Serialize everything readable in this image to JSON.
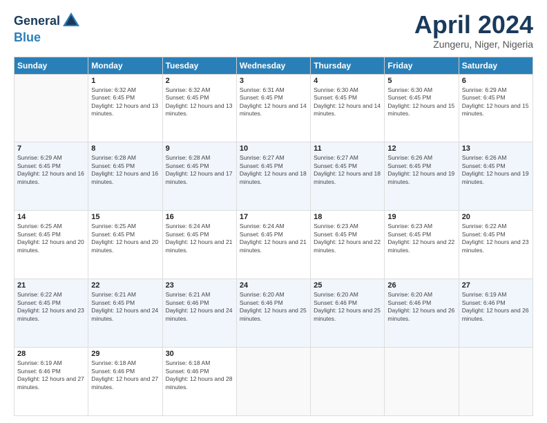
{
  "header": {
    "logo_general": "General",
    "logo_blue": "Blue",
    "month_title": "April 2024",
    "subtitle": "Zungeru, Niger, Nigeria"
  },
  "weekdays": [
    "Sunday",
    "Monday",
    "Tuesday",
    "Wednesday",
    "Thursday",
    "Friday",
    "Saturday"
  ],
  "weeks": [
    [
      {
        "day": "",
        "empty": true
      },
      {
        "day": "1",
        "sunrise": "6:32 AM",
        "sunset": "6:45 PM",
        "daylight": "12 hours and 13 minutes."
      },
      {
        "day": "2",
        "sunrise": "6:32 AM",
        "sunset": "6:45 PM",
        "daylight": "12 hours and 13 minutes."
      },
      {
        "day": "3",
        "sunrise": "6:31 AM",
        "sunset": "6:45 PM",
        "daylight": "12 hours and 14 minutes."
      },
      {
        "day": "4",
        "sunrise": "6:30 AM",
        "sunset": "6:45 PM",
        "daylight": "12 hours and 14 minutes."
      },
      {
        "day": "5",
        "sunrise": "6:30 AM",
        "sunset": "6:45 PM",
        "daylight": "12 hours and 15 minutes."
      },
      {
        "day": "6",
        "sunrise": "6:29 AM",
        "sunset": "6:45 PM",
        "daylight": "12 hours and 15 minutes."
      }
    ],
    [
      {
        "day": "7",
        "sunrise": "6:29 AM",
        "sunset": "6:45 PM",
        "daylight": "12 hours and 16 minutes."
      },
      {
        "day": "8",
        "sunrise": "6:28 AM",
        "sunset": "6:45 PM",
        "daylight": "12 hours and 16 minutes."
      },
      {
        "day": "9",
        "sunrise": "6:28 AM",
        "sunset": "6:45 PM",
        "daylight": "12 hours and 17 minutes."
      },
      {
        "day": "10",
        "sunrise": "6:27 AM",
        "sunset": "6:45 PM",
        "daylight": "12 hours and 18 minutes."
      },
      {
        "day": "11",
        "sunrise": "6:27 AM",
        "sunset": "6:45 PM",
        "daylight": "12 hours and 18 minutes."
      },
      {
        "day": "12",
        "sunrise": "6:26 AM",
        "sunset": "6:45 PM",
        "daylight": "12 hours and 19 minutes."
      },
      {
        "day": "13",
        "sunrise": "6:26 AM",
        "sunset": "6:45 PM",
        "daylight": "12 hours and 19 minutes."
      }
    ],
    [
      {
        "day": "14",
        "sunrise": "6:25 AM",
        "sunset": "6:45 PM",
        "daylight": "12 hours and 20 minutes."
      },
      {
        "day": "15",
        "sunrise": "6:25 AM",
        "sunset": "6:45 PM",
        "daylight": "12 hours and 20 minutes."
      },
      {
        "day": "16",
        "sunrise": "6:24 AM",
        "sunset": "6:45 PM",
        "daylight": "12 hours and 21 minutes."
      },
      {
        "day": "17",
        "sunrise": "6:24 AM",
        "sunset": "6:45 PM",
        "daylight": "12 hours and 21 minutes."
      },
      {
        "day": "18",
        "sunrise": "6:23 AM",
        "sunset": "6:45 PM",
        "daylight": "12 hours and 22 minutes."
      },
      {
        "day": "19",
        "sunrise": "6:23 AM",
        "sunset": "6:45 PM",
        "daylight": "12 hours and 22 minutes."
      },
      {
        "day": "20",
        "sunrise": "6:22 AM",
        "sunset": "6:45 PM",
        "daylight": "12 hours and 23 minutes."
      }
    ],
    [
      {
        "day": "21",
        "sunrise": "6:22 AM",
        "sunset": "6:45 PM",
        "daylight": "12 hours and 23 minutes."
      },
      {
        "day": "22",
        "sunrise": "6:21 AM",
        "sunset": "6:45 PM",
        "daylight": "12 hours and 24 minutes."
      },
      {
        "day": "23",
        "sunrise": "6:21 AM",
        "sunset": "6:46 PM",
        "daylight": "12 hours and 24 minutes."
      },
      {
        "day": "24",
        "sunrise": "6:20 AM",
        "sunset": "6:46 PM",
        "daylight": "12 hours and 25 minutes."
      },
      {
        "day": "25",
        "sunrise": "6:20 AM",
        "sunset": "6:46 PM",
        "daylight": "12 hours and 25 minutes."
      },
      {
        "day": "26",
        "sunrise": "6:20 AM",
        "sunset": "6:46 PM",
        "daylight": "12 hours and 26 minutes."
      },
      {
        "day": "27",
        "sunrise": "6:19 AM",
        "sunset": "6:46 PM",
        "daylight": "12 hours and 26 minutes."
      }
    ],
    [
      {
        "day": "28",
        "sunrise": "6:19 AM",
        "sunset": "6:46 PM",
        "daylight": "12 hours and 27 minutes."
      },
      {
        "day": "29",
        "sunrise": "6:18 AM",
        "sunset": "6:46 PM",
        "daylight": "12 hours and 27 minutes."
      },
      {
        "day": "30",
        "sunrise": "6:18 AM",
        "sunset": "6:46 PM",
        "daylight": "12 hours and 28 minutes."
      },
      {
        "day": "",
        "empty": true
      },
      {
        "day": "",
        "empty": true
      },
      {
        "day": "",
        "empty": true
      },
      {
        "day": "",
        "empty": true
      }
    ]
  ]
}
